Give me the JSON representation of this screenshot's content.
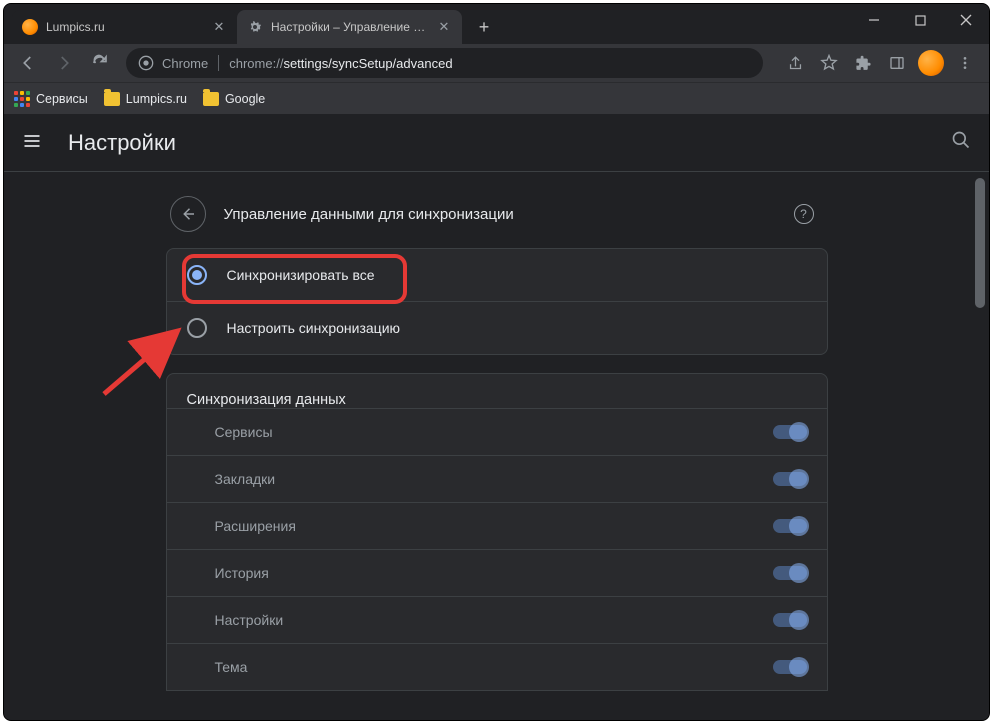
{
  "tabs": [
    {
      "title": "Lumpics.ru"
    },
    {
      "title": "Настройки – Управление данны"
    }
  ],
  "toolbar": {
    "chrome_label": "Chrome",
    "url_prefix": "chrome://",
    "url_path": "settings/syncSetup/advanced"
  },
  "bookmarks": {
    "apps": "Сервисы",
    "items": [
      "Lumpics.ru",
      "Google"
    ]
  },
  "settings": {
    "title": "Настройки",
    "panel_title": "Управление данными для синхронизации",
    "radio_sync_all": "Синхронизировать все",
    "radio_custom": "Настроить синхронизацию",
    "section_title": "Синхронизация данных",
    "toggles": [
      "Сервисы",
      "Закладки",
      "Расширения",
      "История",
      "Настройки",
      "Тема"
    ]
  }
}
